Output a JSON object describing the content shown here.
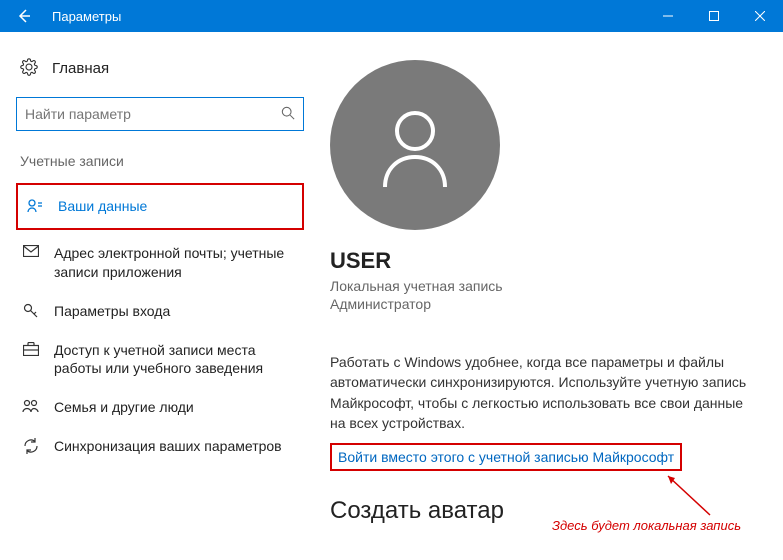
{
  "titlebar": {
    "title": "Параметры"
  },
  "sidebar": {
    "home": "Главная",
    "search_placeholder": "Найти параметр",
    "section": "Учетные записи",
    "items": [
      {
        "label": "Ваши данные"
      },
      {
        "label": "Адрес электронной почты; учетные записи приложения"
      },
      {
        "label": "Параметры входа"
      },
      {
        "label": "Доступ к учетной записи места работы или учебного заведения"
      },
      {
        "label": "Семья и другие люди"
      },
      {
        "label": "Синхронизация ваших параметров"
      }
    ]
  },
  "main": {
    "username": "USER",
    "account_type": "Локальная учетная запись",
    "account_role": "Администратор",
    "description": "Работать с Windows удобнее, когда все параметры и файлы автоматически синхронизируются. Используйте учетную запись Майкрософт, чтобы с легкостью использовать все свои данные на всех устройствах.",
    "signin_link": "Войти вместо этого с учетной записью Майкрософт",
    "create_avatar": "Создать аватар"
  },
  "annotation": {
    "text": "Здесь будет локальная запись"
  }
}
